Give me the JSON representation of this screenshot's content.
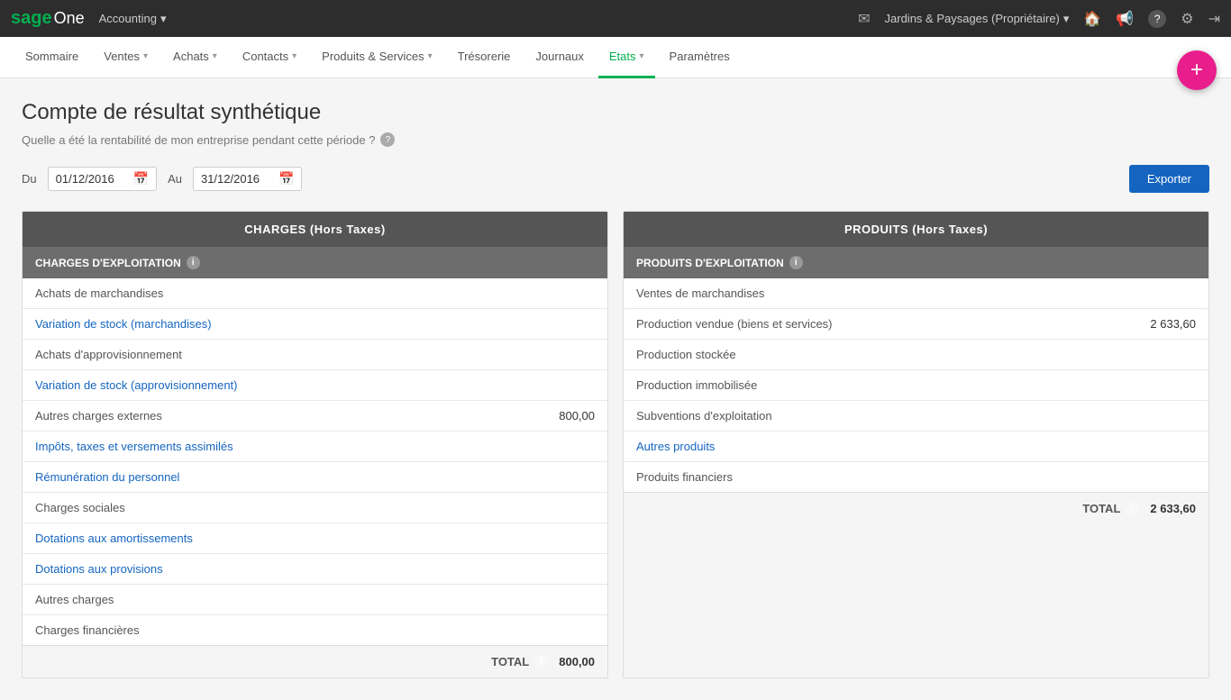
{
  "topNav": {
    "logo": {
      "green": "sage",
      "white": " One"
    },
    "accounting": "Accounting",
    "accounting_arrow": "▾",
    "company": "Jardins & Paysages (Propriétaire)",
    "company_arrow": "▾",
    "icons": [
      "✉",
      "🏠",
      "📢",
      "?",
      "⚙",
      "→"
    ]
  },
  "mainNav": {
    "items": [
      {
        "label": "Sommaire",
        "active": false,
        "hasArrow": false
      },
      {
        "label": "Ventes",
        "active": false,
        "hasArrow": true
      },
      {
        "label": "Achats",
        "active": false,
        "hasArrow": true
      },
      {
        "label": "Contacts",
        "active": false,
        "hasArrow": true
      },
      {
        "label": "Produits & Services",
        "active": false,
        "hasArrow": true
      },
      {
        "label": "Trésorerie",
        "active": false,
        "hasArrow": false
      },
      {
        "label": "Journaux",
        "active": false,
        "hasArrow": false
      },
      {
        "label": "Etats",
        "active": true,
        "hasArrow": true
      },
      {
        "label": "Paramètres",
        "active": false,
        "hasArrow": false
      }
    ]
  },
  "fab": "+",
  "page": {
    "title": "Compte de résultat synthétique",
    "subtitle": "Quelle a été la rentabilité de mon entreprise pendant cette période ?",
    "fromLabel": "Du",
    "toLabel": "Au",
    "fromDate": "01/12/2016",
    "toDate": "31/12/2016",
    "exportLabel": "Exporter"
  },
  "charges": {
    "tableHeader": "CHARGES (Hors Taxes)",
    "sectionHeader": "CHARGES D'EXPLOITATION",
    "rows": [
      {
        "label": "Achats de marchandises",
        "value": "",
        "isLink": false
      },
      {
        "label": "Variation de stock (marchandises)",
        "value": "",
        "isLink": true
      },
      {
        "label": "Achats d'approvisionnement",
        "value": "",
        "isLink": false
      },
      {
        "label": "Variation de stock (approvisionnement)",
        "value": "",
        "isLink": true
      },
      {
        "label": "Autres charges externes",
        "value": "800,00",
        "isLink": false
      },
      {
        "label": "Impôts, taxes et versements assimilés",
        "value": "",
        "isLink": true
      },
      {
        "label": "Rémunération du personnel",
        "value": "",
        "isLink": true
      },
      {
        "label": "Charges sociales",
        "value": "",
        "isLink": false
      },
      {
        "label": "Dotations aux amortissements",
        "value": "",
        "isLink": true
      },
      {
        "label": "Dotations aux provisions",
        "value": "",
        "isLink": true
      },
      {
        "label": "Autres charges",
        "value": "",
        "isLink": false
      },
      {
        "label": "Charges financières",
        "value": "",
        "isLink": false
      }
    ],
    "totalLabel": "TOTAL",
    "totalValue": "800,00"
  },
  "produits": {
    "tableHeader": "PRODUITS (Hors Taxes)",
    "sectionHeader": "PRODUITS D'EXPLOITATION",
    "rows": [
      {
        "label": "Ventes de marchandises",
        "value": "",
        "isLink": false
      },
      {
        "label": "Production vendue (biens et services)",
        "value": "2 633,60",
        "isLink": false
      },
      {
        "label": "Production stockée",
        "value": "",
        "isLink": false
      },
      {
        "label": "Production immobilisée",
        "value": "",
        "isLink": false
      },
      {
        "label": "Subventions d'exploitation",
        "value": "",
        "isLink": false
      },
      {
        "label": "Autres produits",
        "value": "",
        "isLink": true
      },
      {
        "label": "Produits financiers",
        "value": "",
        "isLink": false
      }
    ],
    "totalLabel": "TOTAL",
    "totalValue": "2 633,60"
  }
}
